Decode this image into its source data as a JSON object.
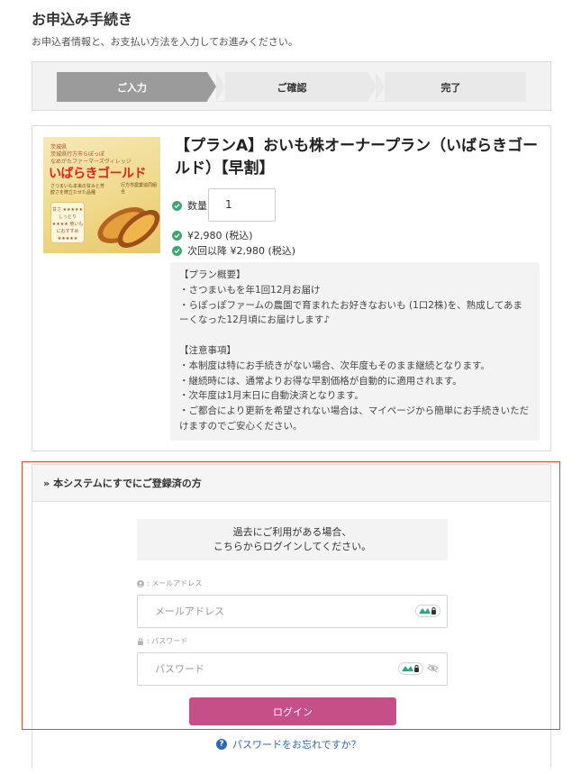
{
  "page": {
    "title": "お申込み手続き",
    "subtitle": "お申込者情報と、お支払い方法を入力してお進みください。"
  },
  "stepper": {
    "steps": [
      {
        "label": "ご入力",
        "active": true
      },
      {
        "label": "ご確認",
        "active": false
      },
      {
        "label": "完了",
        "active": false
      }
    ]
  },
  "product": {
    "title": "【プランA】おいも株オーナープラン（いばらきゴールド）【早割】",
    "image": {
      "brand_line1": "茨城県",
      "brand_line2": "茨城県行方市らぽっぽ",
      "brand_line3": "なめがたファーマーズヴィレッジ",
      "title": "いばらきゴールド",
      "small_text": "さつまいも本来の甘みと芳醇さを際立たせた品種",
      "badge_text": "甘さ ★★★★★ しっとり ★★★★ 焼いもにおすすめ ★★★★★",
      "seal_text": "行方市農業協同組合"
    },
    "quantity_label": "数量",
    "quantity_value": "1",
    "price_label": "¥2,980 (税込)",
    "next_price_label": "次回以降 ¥2,980 (税込)",
    "description": "【プラン概要】\n・さつまいもを年1回12月お届け\n・らぽっぽファームの農園で育まれたお好きなおいも (1口2株)を、熟成してあまーくなった12月頃にお届けします♪\n\n【注意事項】\n・本制度は特にお手続きがない場合、次年度もそのまま継続となります。\n・継続時には、通常よりお得な早割価格が自動的に適用されます。\n・次年度は1月末日に自動決済となります。\n・ご都合により更新を希望されない場合は、マイページから簡単にお手続きいただけますのでご安心ください。"
  },
  "login": {
    "header": "本システムにすでにご登録済の方",
    "notice_line1": "過去にご利用がある場合、",
    "notice_line2": "こちらからログインしてください。",
    "email_label": ": メールアドレス",
    "email_placeholder": "メールアドレス",
    "password_label": ": パスワード",
    "password_placeholder": "パスワード",
    "submit_label": "ログイン",
    "forgot_label": "パスワードをお忘れですか？"
  },
  "colors": {
    "accent": "#c74f88",
    "link": "#2a68b8",
    "check": "#3aa870",
    "highlight": "#e04a2a",
    "step_active": "#9b9b9b"
  }
}
